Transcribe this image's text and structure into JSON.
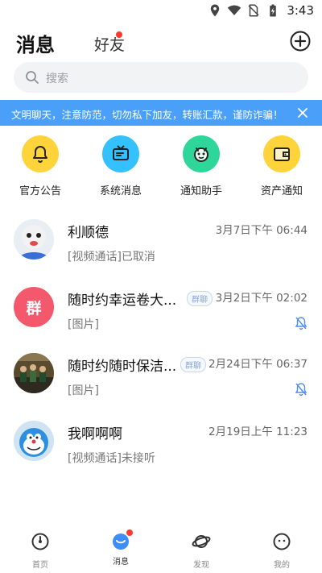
{
  "status_bar": {
    "time": "3:43"
  },
  "header": {
    "title": "消息",
    "friends_tab": "好友"
  },
  "search": {
    "placeholder": "搜索"
  },
  "notice": {
    "text": "文明聊天，注意防范，切勿私下加友，转账汇款，谨防诈骗！"
  },
  "shortcuts": [
    {
      "label": "官方公告",
      "icon": "bell-icon",
      "color": "#ffd43b"
    },
    {
      "label": "系统消息",
      "icon": "tv-icon",
      "color": "#35c0ff"
    },
    {
      "label": "通知助手",
      "icon": "robot-icon",
      "color": "#2fd69a"
    },
    {
      "label": "资产通知",
      "icon": "wallet-icon",
      "color": "#ffd43b"
    }
  ],
  "messages": [
    {
      "name": "利顺德",
      "time": "3月7日下午 06:44",
      "preview": "[视频通话]已取消",
      "group": false,
      "muted": false
    },
    {
      "name": "随时约幸运卷大...",
      "time": "3月2日下午 02:02",
      "preview": "[图片]",
      "group": true,
      "badge": "群聊",
      "avatar_text": "群",
      "muted": true
    },
    {
      "name": "随时约随时保洁...",
      "time": "2月24日下午 06:37",
      "preview": "[图片]",
      "group": true,
      "badge": "群聊",
      "muted": true
    },
    {
      "name": "我啊啊啊",
      "time": "2月19日上午 11:23",
      "preview": "[视频通话]未接听",
      "group": false,
      "muted": false
    }
  ],
  "tabbar": [
    {
      "label": "首页",
      "icon": "home-icon"
    },
    {
      "label": "消息",
      "icon": "message-icon",
      "active": true
    },
    {
      "label": "发现",
      "icon": "planet-icon"
    },
    {
      "label": "我的",
      "icon": "profile-icon"
    }
  ],
  "colors": {
    "accent": "#4aa0f8",
    "badge_red": "#ff3b30",
    "group_avatar": "#f4586c"
  }
}
